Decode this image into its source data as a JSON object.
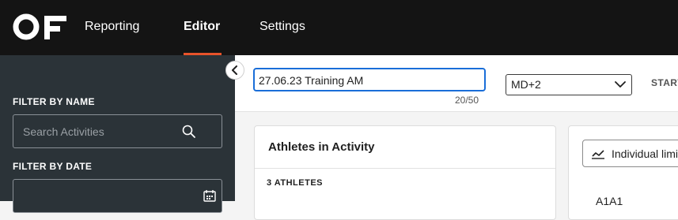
{
  "nav": {
    "logo_text": "OF",
    "items": [
      {
        "label": "Reporting",
        "active": false
      },
      {
        "label": "Editor",
        "active": true
      },
      {
        "label": "Settings",
        "active": false
      }
    ],
    "accent_color": "#e8532a"
  },
  "sidebar": {
    "filter_by_name_label": "FILTER BY NAME",
    "search_placeholder": "Search Activities",
    "search_value": "",
    "filter_by_date_label": "FILTER BY DATE",
    "date_value": "",
    "collapse_icon": "chevron-left-icon"
  },
  "activity": {
    "name_value": "27.06.23 Training AM",
    "char_count": "20/50",
    "md_select_value": "MD+2",
    "start_label": "START"
  },
  "athletes_card": {
    "title": "Athletes in Activity",
    "count_label": "3 ATHLETES"
  },
  "right_card": {
    "button_label": "Individual limits",
    "button_icon": "line-chart-icon",
    "first_item": "A1A1"
  }
}
